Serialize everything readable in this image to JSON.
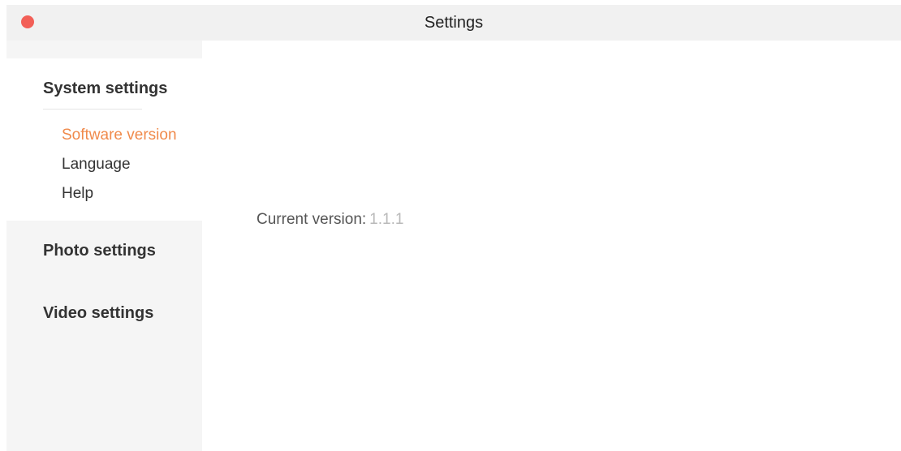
{
  "window": {
    "title": "Settings"
  },
  "sidebar": {
    "groups": [
      {
        "label": "System settings",
        "items": [
          {
            "label": "Software version",
            "active": true
          },
          {
            "label": "Language",
            "active": false
          },
          {
            "label": "Help",
            "active": false
          }
        ]
      },
      {
        "label": "Photo settings"
      },
      {
        "label": "Video settings"
      }
    ]
  },
  "content": {
    "version_label": "Current version:",
    "version_value": "1.1.1"
  },
  "colors": {
    "accent": "#f08a4b",
    "close_button": "#f25f57",
    "titlebar_bg": "#f1f1f1",
    "sidebar_bg": "#f5f5f5"
  }
}
